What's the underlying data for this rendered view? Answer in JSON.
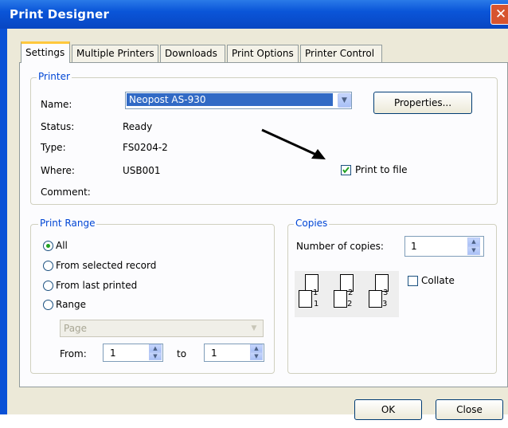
{
  "window": {
    "title": "Print Designer"
  },
  "tabs": [
    {
      "label": "Settings"
    },
    {
      "label": "Multiple Printers"
    },
    {
      "label": "Downloads"
    },
    {
      "label": "Print Options"
    },
    {
      "label": "Printer Control"
    }
  ],
  "printer": {
    "legend": "Printer",
    "name_label": "Name:",
    "name_value": "Neopost AS-930",
    "properties_label": "Properties...",
    "status_label": "Status:",
    "status_value": "Ready",
    "type_label": "Type:",
    "type_value": "FS0204-2",
    "where_label": "Where:",
    "where_value": "USB001",
    "comment_label": "Comment:",
    "print_to_file_label": "Print to file",
    "print_to_file_checked": true
  },
  "print_range": {
    "legend": "Print Range",
    "options": [
      {
        "label": "All",
        "selected": true
      },
      {
        "label": "From selected record",
        "selected": false
      },
      {
        "label": "From last printed",
        "selected": false
      },
      {
        "label": "Range",
        "selected": false
      }
    ],
    "unit_value": "Page",
    "from_label": "From:",
    "from_value": "1",
    "to_label": "to",
    "to_value": "1"
  },
  "copies": {
    "legend": "Copies",
    "number_label": "Number of copies:",
    "number_value": "1",
    "collate_label": "Collate",
    "collate_checked": false,
    "page_numbers": [
      "1",
      "1",
      "2",
      "2",
      "3",
      "3"
    ]
  },
  "footer": {
    "ok_label": "OK",
    "close_label": "Close"
  },
  "icons": {
    "close": "close-icon",
    "dropdown": "chevron-down-icon",
    "arrow": "arrow-annotation"
  },
  "colors": {
    "title_bar": "#0a51d6",
    "legend_text": "#0046d5",
    "selection": "#316ac5",
    "tab_highlight": "#ffc83c"
  }
}
